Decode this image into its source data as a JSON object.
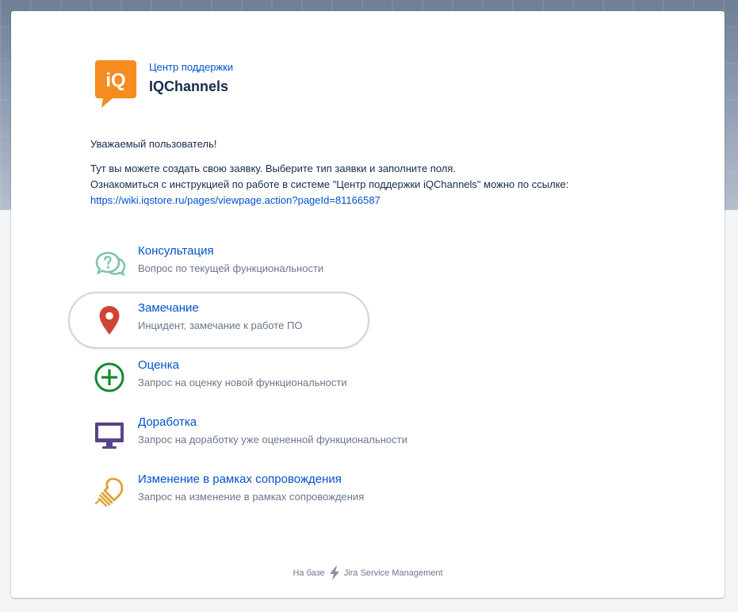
{
  "portal": {
    "subtitle": "Центр поддержки",
    "name": "IQChannels",
    "logo_text": "iQ",
    "accent_color": "#f68b1f"
  },
  "intro": {
    "greeting": "Уважаемый пользователь!",
    "line1": "Тут вы можете создать свою заявку. Выберите тип заявки и заполните поля.",
    "line2": "Ознакомиться с инструкцией по работе в системе \"Центр поддержки iQChannels\" можно по ссылке:",
    "link": "https://wiki.iqstore.ru/pages/viewpage.action?pageId=81166587"
  },
  "request_types": [
    {
      "icon": "question-chat-icon",
      "title": "Консультация",
      "description": "Вопрос по текущей функциональности",
      "color": "#7fc4a8"
    },
    {
      "icon": "map-pin-icon",
      "title": "Замечание",
      "description": "Инцидент, замечание к работе ПО",
      "color": "#d04437"
    },
    {
      "icon": "plus-circle-icon",
      "title": "Оценка",
      "description": "Запрос на оценку новой функциональности",
      "color": "#14892c"
    },
    {
      "icon": "monitor-icon",
      "title": "Доработка",
      "description": "Запрос на доработку уже оцененной функциональности",
      "color": "#594387"
    },
    {
      "icon": "light-bulb-icon",
      "title": "Изменение в рамках сопровождения",
      "description": "Запрос на изменение в рамках сопровождения",
      "color": "#e0a235"
    }
  ],
  "footer": {
    "prefix": "На базе",
    "product": "Jira Service Management"
  }
}
